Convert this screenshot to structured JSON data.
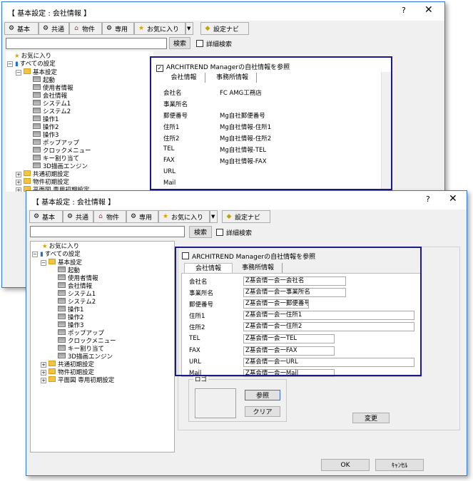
{
  "window": {
    "title": "【 基本設定 : 会社情報 】",
    "help": "?",
    "close": "✕"
  },
  "toolbar": {
    "basic": "基本",
    "common": "共通",
    "property": "物件",
    "dedicated": "専用",
    "favorites": "お気に入り",
    "dropdown_arrow": "▼",
    "settings_navi": "設定ナビ"
  },
  "search": {
    "button": "検索",
    "detail_label": "詳細検索"
  },
  "tree": {
    "favorites": "お気に入り",
    "all_settings": "すべての設定",
    "basic_settings": "基本設定",
    "children": [
      "起動",
      "使用者情報",
      "会社情報",
      "システム1",
      "システム2",
      "操作1",
      "操作2",
      "操作3",
      "ポップアップ",
      "クロックメニュー",
      "キー割り当て",
      "3D描画エンジン"
    ],
    "common_initial": "共通初期設定",
    "property_initial": "物件初期設定",
    "floorplan_initial": "平面図 専用初期設定",
    "expand_minus": "−",
    "expand_plus": "+"
  },
  "back_panel": {
    "checkbox_label": "ARCHITREND Managerの自社情報を参照",
    "checkbox_mark": "✓",
    "tab_company": "会社情報",
    "tab_office": "事務所情報",
    "rows": [
      {
        "label": "会社名",
        "value": "FC AMG工務店"
      },
      {
        "label": "事業所名",
        "value": ""
      },
      {
        "label": "郵便番号",
        "value": "Mg自社郵便番号"
      },
      {
        "label": "住所1",
        "value": "Mg自社情報-住所1"
      },
      {
        "label": "住所2",
        "value": "Mg自社情報-住所2"
      },
      {
        "label": "TEL",
        "value": "Mg自社情報-TEL"
      },
      {
        "label": "FAX",
        "value": "Mg自社情報-FAX"
      },
      {
        "label": "URL",
        "value": ""
      },
      {
        "label": "Mail",
        "value": ""
      }
    ],
    "logo_partial": "ロゴ"
  },
  "front_panel": {
    "checkbox_label": "ARCHITREND Managerの自社情報を参照",
    "tab_company": "会社情報",
    "tab_office": "事務所情報",
    "rows": [
      {
        "label": "会社名",
        "value": "Z基会情一会一会社名"
      },
      {
        "label": "事業所名",
        "value": "Z基会情一会一事業所名"
      },
      {
        "label": "郵便番号",
        "value": "Z基会情一会一郵便番号"
      },
      {
        "label": "住所1",
        "value": "Z基会情一会一住所1"
      },
      {
        "label": "住所2",
        "value": "Z基会情一会一住所2"
      },
      {
        "label": "TEL",
        "value": "Z基会情一会一TEL"
      },
      {
        "label": "FAX",
        "value": "Z基会情一会一FAX"
      },
      {
        "label": "URL",
        "value": "Z基会情一会一URL"
      },
      {
        "label": "Mail",
        "value": "Z基会情一会一Mail"
      }
    ],
    "logo_label": "ロゴ",
    "browse": "参照",
    "clear": "クリア",
    "change": "変更"
  },
  "footer": {
    "ok": "OK",
    "cancel": "ｷｬﾝｾﾙ"
  }
}
